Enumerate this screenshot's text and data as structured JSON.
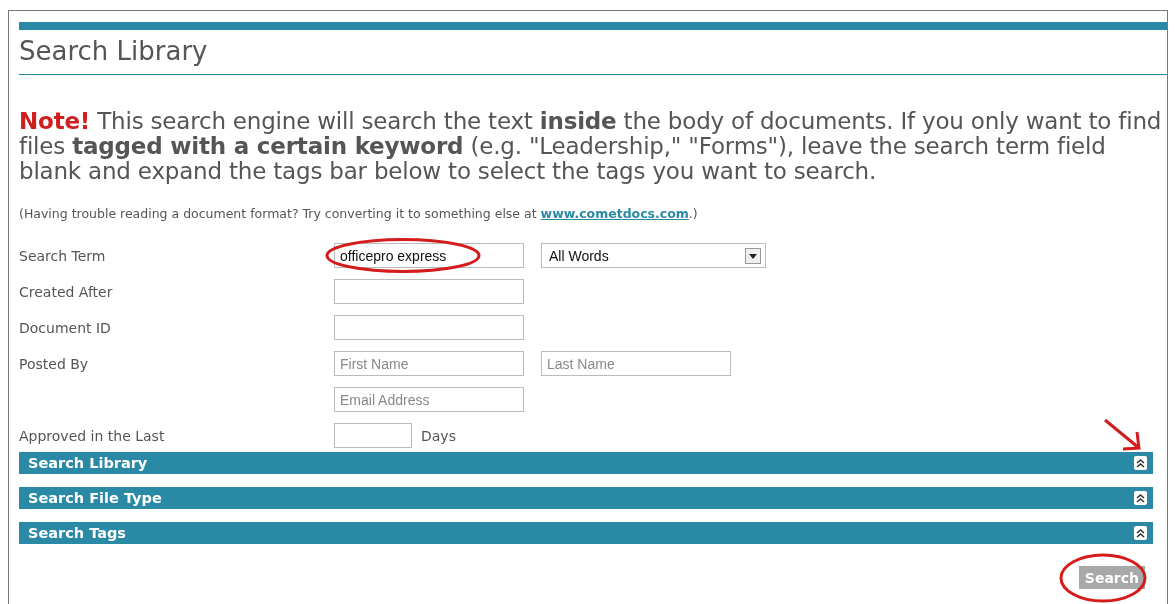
{
  "title": "Search Library",
  "note": "**Note!** This search engine will search the text **inside** the body of documents. If you only want to find files **tagged with a certain keyword** (e.g. \"Leadership,\" \"Forms\"), leave the search term field blank and expand the tags bar below to select the tags you want to search.",
  "help": {
    "before": "(Having trouble reading a document format? Try converting it to something else at ",
    "link": "www.cometdocs.com",
    "after": ".)"
  },
  "rows": [
    {
      "label": "Search Term",
      "fields": [
        {
          "kind": "text",
          "value": "officepro express",
          "highlighted": true
        },
        {
          "kind": "select",
          "value": "All Words"
        }
      ]
    },
    {
      "label": "Created After",
      "fields": [
        {
          "kind": "text"
        }
      ]
    },
    {
      "label": "Document ID",
      "fields": [
        {
          "kind": "text"
        }
      ]
    },
    {
      "label": "Posted By",
      "fields": [
        {
          "kind": "text",
          "placeholder": "First Name"
        },
        {
          "kind": "text",
          "placeholder": "Last Name"
        }
      ]
    },
    {
      "fields": [
        {
          "kind": "text",
          "placeholder": "Email Address"
        }
      ]
    },
    {
      "label": "Approved in the Last",
      "fields": [
        {
          "kind": "short"
        },
        {
          "kind": "suffix",
          "text": "Days"
        }
      ]
    }
  ],
  "panels": [
    {
      "title": "Search Library",
      "pointed": true
    },
    {
      "title": "Search File Type"
    },
    {
      "title": "Search Tags"
    }
  ],
  "button": {
    "label": "Search",
    "highlighted": true
  }
}
